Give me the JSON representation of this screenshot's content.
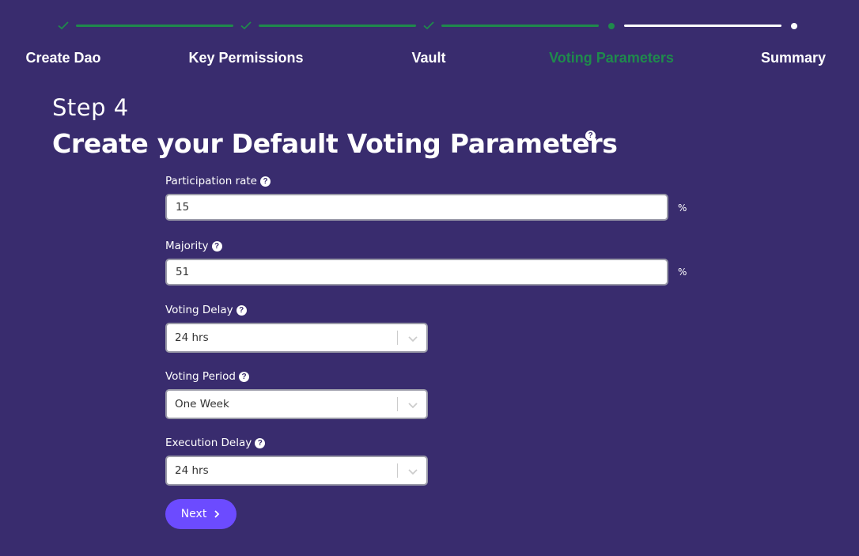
{
  "stepper": {
    "steps": [
      {
        "label": "Create Dao",
        "status": "complete"
      },
      {
        "label": "Key Permissions",
        "status": "complete"
      },
      {
        "label": "Vault",
        "status": "complete"
      },
      {
        "label": "Voting Parameters",
        "status": "active"
      },
      {
        "label": "Summary",
        "status": "pending"
      }
    ],
    "colors": {
      "complete": "#1f8a4c",
      "active": "#1f8a4c",
      "pending": "#ffffff"
    }
  },
  "header": {
    "step": "Step 4",
    "title": "Create your Default Voting Parameters",
    "help_icon": "question-circle-icon"
  },
  "form": {
    "participation_rate": {
      "label": "Participation rate",
      "value": "15",
      "unit": "%"
    },
    "majority": {
      "label": "Majority",
      "value": "51",
      "unit": "%"
    },
    "voting_delay": {
      "label": "Voting Delay",
      "value": "24 hrs"
    },
    "voting_period": {
      "label": "Voting Period",
      "value": "One Week"
    },
    "execution_delay": {
      "label": "Execution Delay",
      "value": "24 hrs"
    },
    "next_label": "Next"
  },
  "theme": {
    "background": "#392c6e",
    "accent": "#6c4bff",
    "success": "#1f8a4c"
  }
}
